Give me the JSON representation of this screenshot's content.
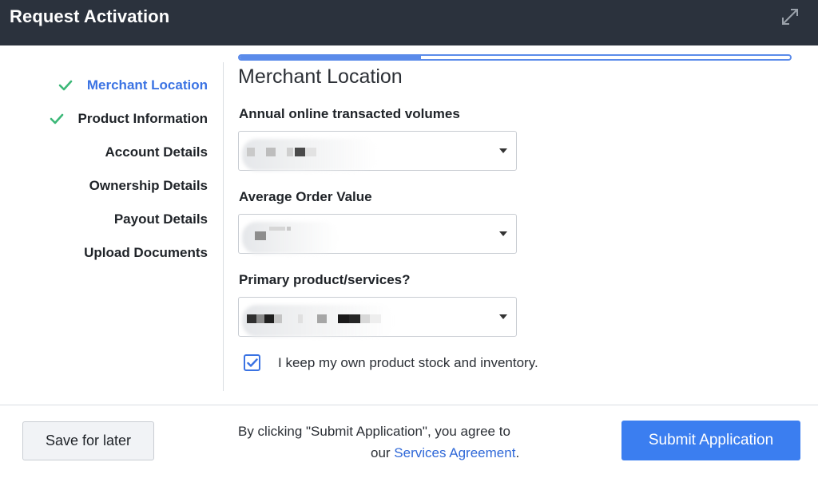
{
  "window": {
    "title": "Request Activation",
    "expand_icon": "expand-diagonal-icon"
  },
  "sidebar": {
    "steps": [
      {
        "label": "Merchant Location",
        "completed": true,
        "active": true
      },
      {
        "label": "Product Information",
        "completed": true,
        "active": false
      },
      {
        "label": "Account Details",
        "completed": false,
        "active": false
      },
      {
        "label": "Ownership Details",
        "completed": false,
        "active": false
      },
      {
        "label": "Payout Details",
        "completed": false,
        "active": false
      },
      {
        "label": "Upload Documents",
        "completed": false,
        "active": false
      }
    ]
  },
  "progress": {
    "fraction": 0.33
  },
  "form": {
    "section_title": "Merchant Location",
    "fields": [
      {
        "label": "Annual online transacted volumes",
        "value_redacted": true
      },
      {
        "label": "Average Order Value",
        "value_redacted": true
      },
      {
        "label": "Primary product/services?",
        "value_redacted": true
      }
    ],
    "inventory_checkbox": {
      "label": "I keep my own product stock and inventory.",
      "checked": true
    }
  },
  "footer": {
    "save_label": "Save for later",
    "agreement_line1": "By clicking \"Submit Application\", you agree to",
    "agreement_prefix": "our ",
    "agreement_link": "Services Agreement",
    "agreement_suffix": ".",
    "submit_label": "Submit Application"
  },
  "colors": {
    "header_bg": "#2b323d",
    "accent": "#3b73e3",
    "check_green": "#3cb878",
    "submit_bg": "#3b7ef0"
  }
}
